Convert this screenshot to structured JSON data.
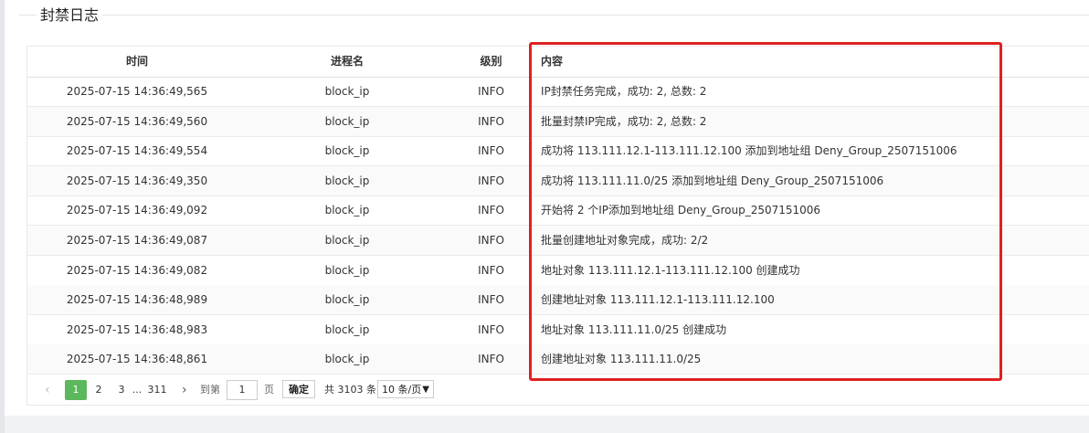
{
  "section": {
    "title": "封禁日志"
  },
  "table": {
    "headers": {
      "time": "时间",
      "process": "进程名",
      "level": "级别",
      "message": "内容"
    },
    "rows": [
      {
        "time": "2025-07-15 14:36:49,565",
        "process": "block_ip",
        "level": "INFO",
        "message": "IP封禁任务完成，成功: 2, 总数: 2"
      },
      {
        "time": "2025-07-15 14:36:49,560",
        "process": "block_ip",
        "level": "INFO",
        "message": "批量封禁IP完成，成功: 2, 总数: 2"
      },
      {
        "time": "2025-07-15 14:36:49,554",
        "process": "block_ip",
        "level": "INFO",
        "message": "成功将 113.111.12.1-113.111.12.100 添加到地址组 Deny_Group_2507151006"
      },
      {
        "time": "2025-07-15 14:36:49,350",
        "process": "block_ip",
        "level": "INFO",
        "message": "成功将 113.111.11.0/25 添加到地址组 Deny_Group_2507151006"
      },
      {
        "time": "2025-07-15 14:36:49,092",
        "process": "block_ip",
        "level": "INFO",
        "message": "开始将 2 个IP添加到地址组 Deny_Group_2507151006"
      },
      {
        "time": "2025-07-15 14:36:49,087",
        "process": "block_ip",
        "level": "INFO",
        "message": "批量创建地址对象完成，成功: 2/2"
      },
      {
        "time": "2025-07-15 14:36:49,082",
        "process": "block_ip",
        "level": "INFO",
        "message": "地址对象 113.111.12.1-113.111.12.100 创建成功"
      },
      {
        "time": "2025-07-15 14:36:48,989",
        "process": "block_ip",
        "level": "INFO",
        "message": "创建地址对象 113.111.12.1-113.111.12.100"
      },
      {
        "time": "2025-07-15 14:36:48,983",
        "process": "block_ip",
        "level": "INFO",
        "message": "地址对象 113.111.11.0/25 创建成功"
      },
      {
        "time": "2025-07-15 14:36:48,861",
        "process": "block_ip",
        "level": "INFO",
        "message": "创建地址对象 113.111.11.0/25"
      }
    ]
  },
  "pagination": {
    "prev_icon": "chevron-left-icon",
    "next_icon": "chevron-right-icon",
    "pages": [
      "1",
      "2",
      "3",
      "...",
      "311"
    ],
    "current_page": "1",
    "goto_label": "到第",
    "goto_value": "1",
    "page_suffix": "页",
    "confirm_label": "确定",
    "total_text": "共 3103 条",
    "page_size": "10 条/页",
    "active_color": "#5cb85c"
  },
  "highlight": {
    "color": "#e02020"
  }
}
